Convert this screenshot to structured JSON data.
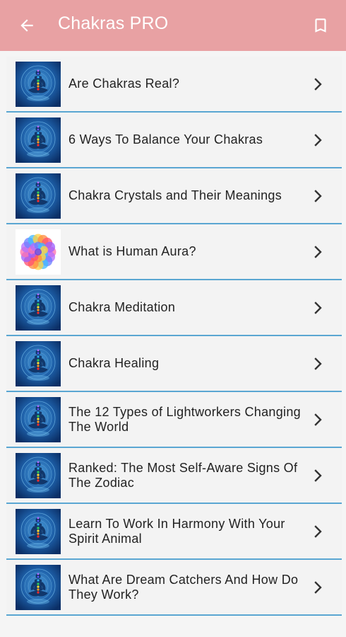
{
  "appbar": {
    "title": "Chakras PRO",
    "back_icon": "arrow-left-icon",
    "bookmark_icon": "bookmark-icon",
    "color": "#e8a1a3"
  },
  "list": {
    "divider_color": "#5aa6d2",
    "items": [
      {
        "label": "Are Chakras Real?",
        "thumb": "chakra-meditation"
      },
      {
        "label": "6 Ways To Balance Your Chakras",
        "thumb": "chakra-meditation"
      },
      {
        "label": "Chakra Crystals and Their Meanings",
        "thumb": "chakra-meditation"
      },
      {
        "label": "What is Human Aura?",
        "thumb": "aura-flower"
      },
      {
        "label": "Chakra Meditation",
        "thumb": "chakra-meditation"
      },
      {
        "label": "Chakra Healing",
        "thumb": "chakra-meditation"
      },
      {
        "label": "The 12 Types of Lightworkers Changing The World",
        "thumb": "chakra-meditation"
      },
      {
        "label": "Ranked: The Most Self-Aware Signs Of The Zodiac",
        "thumb": "chakra-meditation"
      },
      {
        "label": "Learn To Work In Harmony With Your Spirit Animal",
        "thumb": "chakra-meditation"
      },
      {
        "label": "What Are Dream Catchers And How Do They Work?",
        "thumb": "chakra-meditation"
      }
    ]
  }
}
